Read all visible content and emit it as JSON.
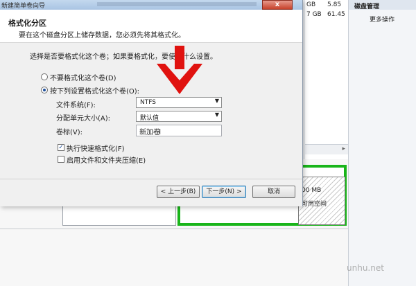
{
  "dialog": {
    "title": "新建简单卷向导",
    "close_glyph": "x",
    "header_title": "格式化分区",
    "header_subtitle": "要在这个磁盘分区上储存数据，您必须先将其格式化。",
    "prompt": "选择是否要格式化这个卷；如果要格式化，要使用什么设置。",
    "options": [
      {
        "label": "不要格式化这个卷(D)",
        "selected": false
      },
      {
        "label": "按下列设置格式化这个卷(O):",
        "selected": true
      }
    ],
    "fields": {
      "filesystem_label": "文件系统(F):",
      "filesystem_value": "NTFS",
      "alloc_label": "分配单元大小(A):",
      "alloc_value": "默认值",
      "volume_label_label": "卷标(V):",
      "volume_label_value": "新加卷"
    },
    "checkboxes": {
      "quick_format_label": "执行快速格式化(F)",
      "quick_format_checked": true,
      "compression_label": "启用文件和文件夹压缩(E)",
      "compression_checked": false
    },
    "buttons": {
      "back": "< 上一步(B)",
      "next": "下一步(N) >",
      "cancel": "取消"
    }
  },
  "background": {
    "table_row1": [
      "GB",
      "5.85"
    ],
    "table_row2": [
      "7 GB",
      "61.45"
    ],
    "operations_header": "磁盘管理",
    "operations_more": "更多操作",
    "partition_free_size": "00 MB",
    "partition_free_label": "可用空间",
    "watermark": "unhu.net"
  },
  "colors": {
    "arrow": "#e0120f",
    "partition_border": "#19b51a"
  },
  "icons": {
    "arrow": "down-arrow-icon",
    "dropdown": "chevron-down-icon",
    "check": "checkmark-icon"
  }
}
